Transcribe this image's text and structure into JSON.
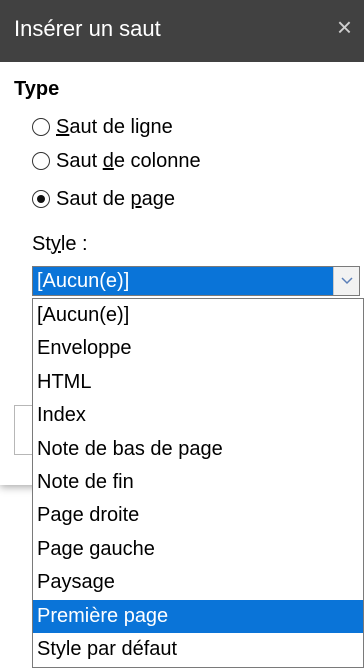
{
  "dialog": {
    "title": "Insérer un saut",
    "close_glyph": "×"
  },
  "type_section": {
    "label": "Type",
    "options": [
      {
        "pre": "",
        "u": "S",
        "post": "aut de ligne",
        "selected": false
      },
      {
        "pre": "Saut ",
        "u": "d",
        "post": "e colonne",
        "selected": false
      },
      {
        "pre": "Saut de ",
        "u": "p",
        "post": "age",
        "selected": true
      }
    ]
  },
  "style": {
    "label_pre": "St",
    "label_u": "y",
    "label_post": "le :",
    "selected_value": "[Aucun(e)]",
    "options": [
      "[Aucun(e)]",
      "Enveloppe",
      "HTML",
      "Index",
      "Note de bas de page",
      "Note de fin",
      "Page droite",
      "Page gauche",
      "Paysage",
      "Première page",
      "Style par défaut"
    ],
    "highlighted_option": "Première page"
  },
  "icons": {
    "close": "close-icon",
    "dropdown": "chevron-down-icon"
  },
  "colors": {
    "titlebar": "#414141",
    "selection": "#0a74d8"
  }
}
